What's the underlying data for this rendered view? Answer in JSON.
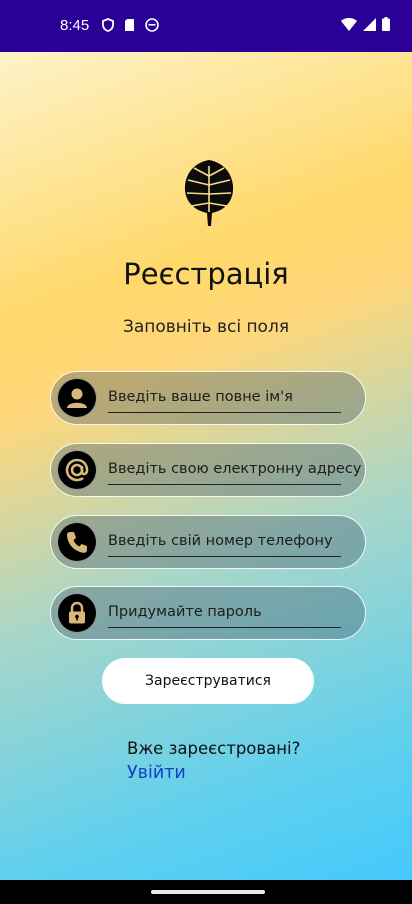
{
  "status": {
    "time": "8:45",
    "left_icons": [
      "shield-icon",
      "sd-card-icon",
      "android-icon"
    ],
    "right_icons": [
      "wifi-icon",
      "signal-icon",
      "battery-icon"
    ]
  },
  "header": {
    "logo_icon": "monstera-leaf-icon",
    "title": "Реєстрація",
    "subtitle": "Заповніть всі поля"
  },
  "form": {
    "fields": [
      {
        "icon": "person-icon",
        "placeholder": "Введіть ваше повне ім'я"
      },
      {
        "icon": "at-sign-icon",
        "placeholder": "Введіть свою електронну адресу"
      },
      {
        "icon": "phone-icon",
        "placeholder": "Введіть свій номер телефону"
      },
      {
        "icon": "lock-icon",
        "placeholder": "Придумайте пароль"
      }
    ],
    "submit_label": "Зареєструватися"
  },
  "footer": {
    "question": "Вже зареєстровані?",
    "login_link": "Увійти"
  },
  "colors": {
    "status_bar": "#2a0096",
    "link": "#1240c8",
    "icon_accent": "#d8b878"
  }
}
